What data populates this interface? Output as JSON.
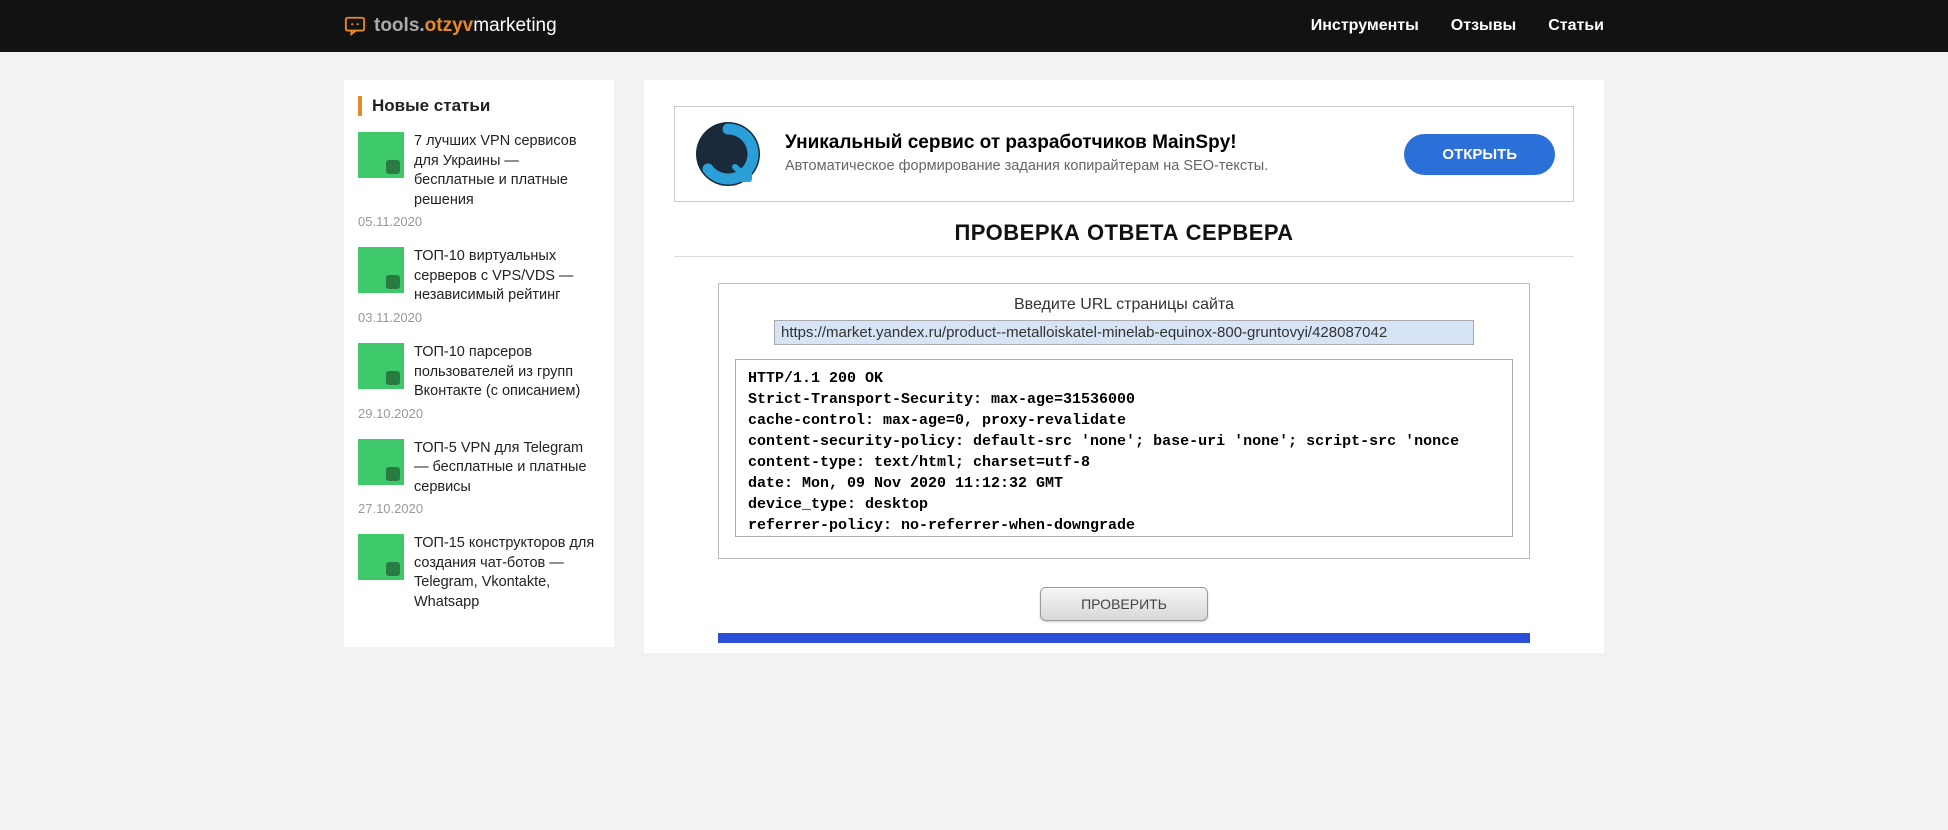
{
  "header": {
    "logo_prefix": "tools.",
    "logo_orange": "otzyv",
    "logo_suffix": "marketing",
    "nav": [
      "Инструменты",
      "Отзывы",
      "Статьи"
    ]
  },
  "sidebar": {
    "title": "Новые статьи",
    "articles": [
      {
        "title": "7 лучших VPN сервисов для Украины — бесплатные и платные решения",
        "date": "05.11.2020"
      },
      {
        "title": "ТОП-10 виртуальных серверов с VPS/VDS — независимый рейтинг",
        "date": "03.11.2020"
      },
      {
        "title": "ТОП-10 парсеров пользователей из групп Вконтакте (с описанием)",
        "date": "29.10.2020"
      },
      {
        "title": "ТОП-5 VPN для Telegram — бесплатные и платные сервисы",
        "date": "27.10.2020"
      },
      {
        "title": "ТОП-15 конструкторов для создания чат-ботов — Telegram, Vkontakte, Whatsapp",
        "date": ""
      }
    ]
  },
  "promo": {
    "title": "Уникальный сервис от разработчиков MainSpy!",
    "subtitle": "Автоматическое формирование задания копирайтерам на SEO-тексты.",
    "button": "ОТКРЫТЬ"
  },
  "main": {
    "title": "ПРОВЕРКА ОТВЕТА СЕРВЕРА",
    "form_label": "Введите URL страницы сайта",
    "url_value": "https://market.yandex.ru/product--metalloiskatel-minelab-equinox-800-gruntovyi/428087042",
    "response_text": "HTTP/1.1 200 OK\nStrict-Transport-Security: max-age=31536000\ncache-control: max-age=0, proxy-revalidate\ncontent-security-policy: default-src 'none'; base-uri 'none'; script-src 'nonce\ncontent-type: text/html; charset=utf-8\ndate: Mon, 09 Nov 2020 11:12:32 GMT\ndevice_type: desktop\nreferrer-policy: no-referrer-when-downgrade",
    "check_button": "ПРОВЕРИТЬ"
  }
}
